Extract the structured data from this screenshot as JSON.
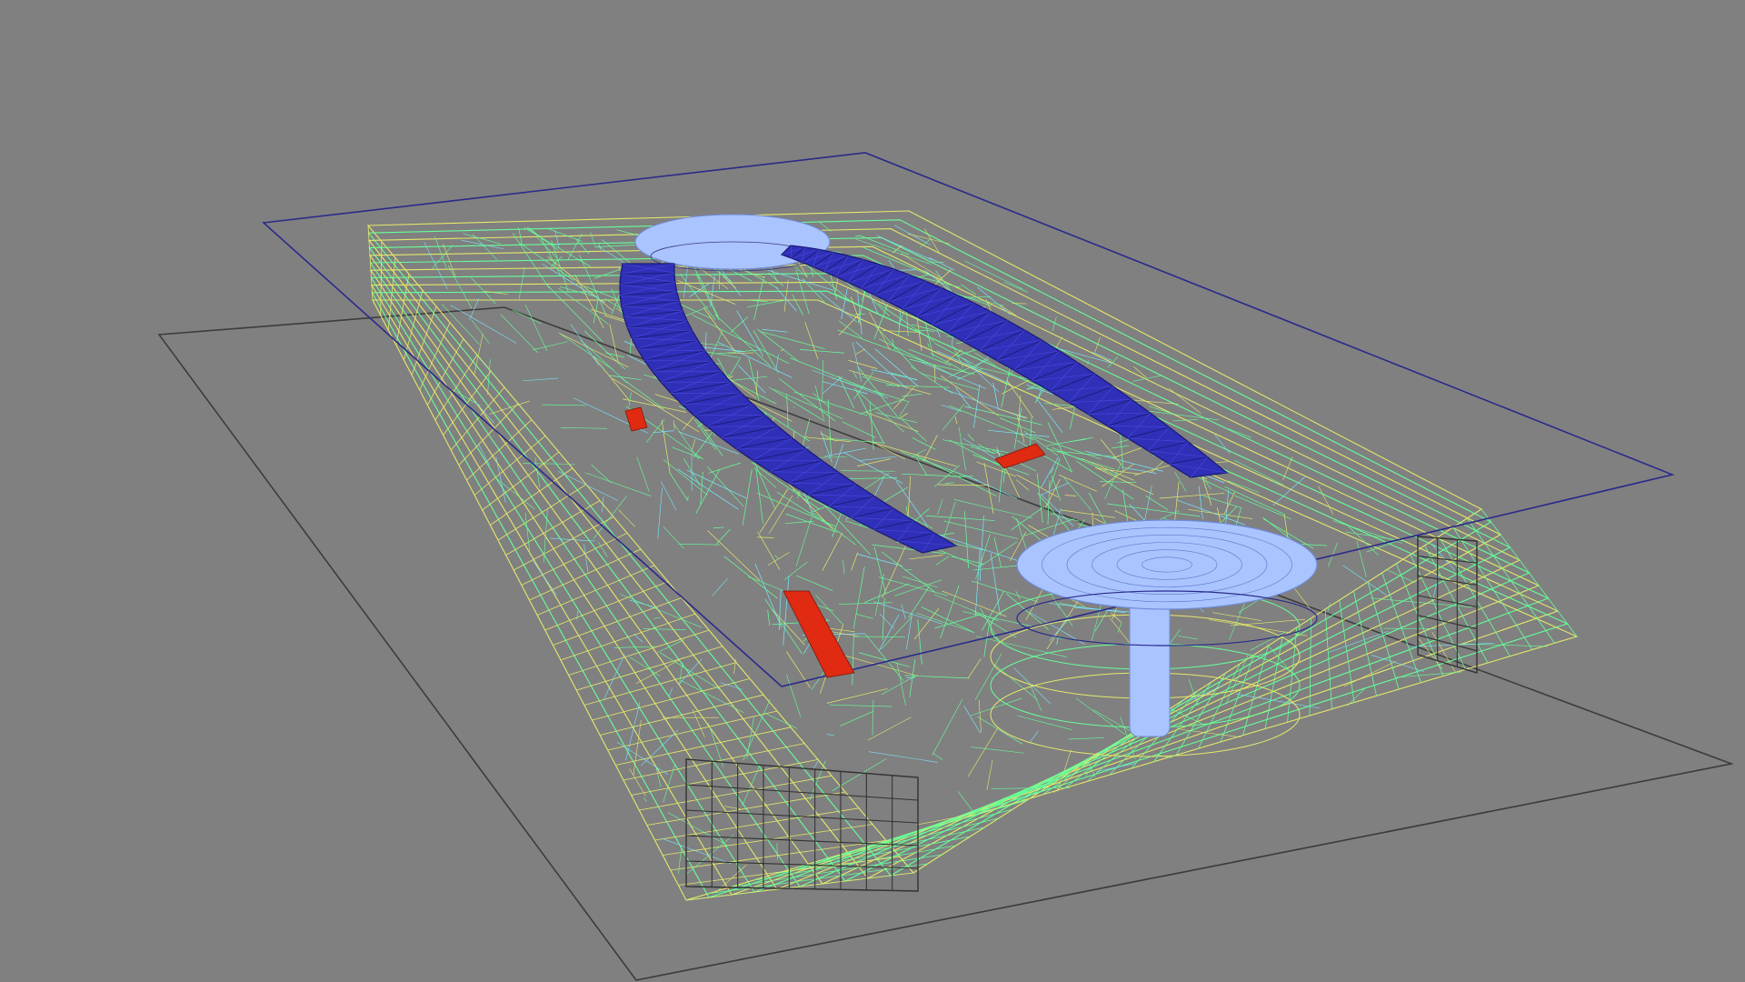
{
  "viewport": {
    "background_color": "#808080"
  },
  "colors": {
    "ground_outline": "#3c3c3c",
    "section_plane": "#2a2a8a",
    "wire_green": "#66ff99",
    "wire_yellow": "#e4e86a",
    "wire_cyan": "#78e6ff",
    "roof_blue": "#2f2fb8",
    "roof_lattice": "#1a1a70",
    "dome_fill": "#a9c4ff",
    "red_mark": "#e02a12",
    "window_grid": "#333333"
  },
  "objects": [
    {
      "name": "ground-plane",
      "type": "wire-rectangle"
    },
    {
      "name": "section-plane",
      "type": "wire-rectangle"
    },
    {
      "name": "building-mass",
      "type": "wireframe-mesh"
    },
    {
      "name": "west-arched-roof",
      "type": "space-truss"
    },
    {
      "name": "east-arched-roof",
      "type": "space-truss"
    },
    {
      "name": "north-dome",
      "type": "dome"
    },
    {
      "name": "south-rotunda",
      "type": "dome-on-column"
    },
    {
      "name": "window-grid-front",
      "type": "window-grid"
    },
    {
      "name": "window-grid-side",
      "type": "window-grid"
    }
  ]
}
